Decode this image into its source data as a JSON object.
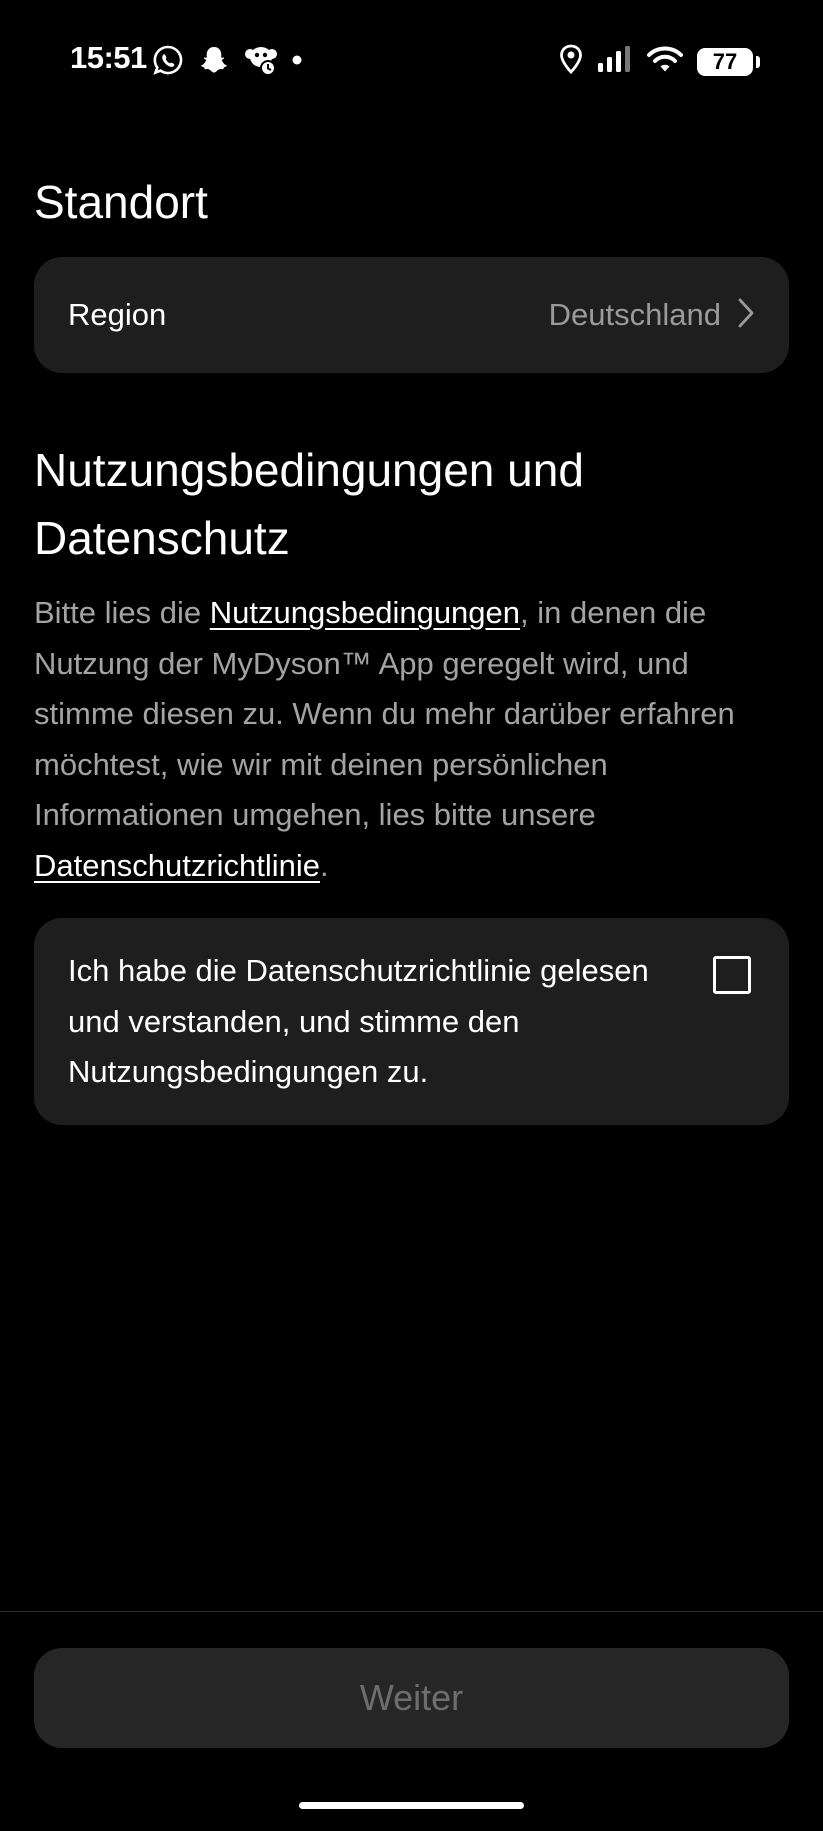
{
  "status_bar": {
    "time": "15:51",
    "left_icons": [
      "whatsapp-icon",
      "snapchat-icon",
      "monkey-app-icon",
      "dot-icon"
    ],
    "right_icons": [
      "location-icon",
      "signal-icon",
      "wifi-icon",
      "battery-icon"
    ],
    "battery_level": "77"
  },
  "location_section": {
    "title": "Standort",
    "region_label": "Region",
    "region_value": "Deutschland"
  },
  "terms_section": {
    "title": "Nutzungsbedingungen und Datenschutz",
    "body_prefix": "Bitte lies die ",
    "terms_link": "Nutzungsbedingungen",
    "body_middle": ", in denen die Nutzung der MyDyson™ App geregelt wird, und stimme diesen zu. Wenn du mehr darüber erfahren möchtest, wie wir mit deinen persönlichen Informationen umgehen, lies bitte unsere ",
    "privacy_link": "Datenschutzrichtlinie",
    "body_suffix": "."
  },
  "consent": {
    "label": "Ich habe die Datenschutzrichtlinie gelesen und verstanden, und stimme den Nutzungsbedingungen zu.",
    "checked": false
  },
  "footer": {
    "continue_label": "Weiter",
    "continue_enabled": false
  },
  "colors": {
    "background": "#000000",
    "card": "#1e1e1e",
    "muted_text": "#a3a3a3",
    "disabled_button": "#262626",
    "disabled_text": "#6e6e6e"
  }
}
